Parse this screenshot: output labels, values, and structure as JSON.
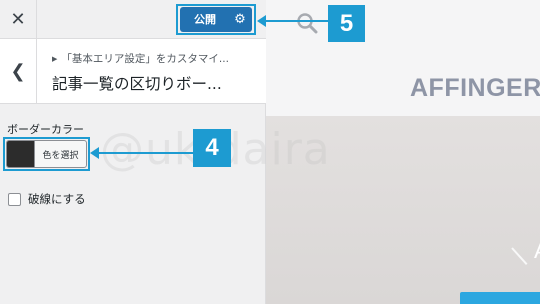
{
  "topbar": {
    "close_icon": "close-icon",
    "publish_label": "公開",
    "settings_icon": "gear-icon"
  },
  "section": {
    "breadcrumb": "「基本エリア設定」をカスタマイ...",
    "title": "記事一覧の区切りボー..."
  },
  "control": {
    "label": "ボーダーカラー",
    "color_button_label": "色を選択",
    "swatch_color": "#2c2c2c"
  },
  "option": {
    "dashed_label": "破線にする"
  },
  "preview": {
    "brand": "AFFINGER",
    "hero_glyph": "A"
  },
  "watermark": "@ukidaira",
  "annotations": {
    "badge_5": "5",
    "badge_4": "4",
    "highlight_color": "#1d9bd1"
  },
  "colors": {
    "accent": "#2271b1",
    "annotation": "#1d9bd1"
  }
}
